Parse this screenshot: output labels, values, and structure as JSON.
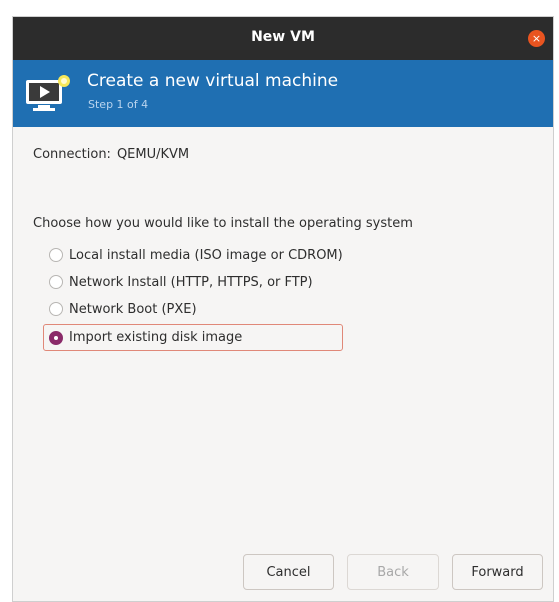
{
  "window": {
    "title": "New VM",
    "close_icon": "close-icon",
    "close_glyph": "×"
  },
  "banner": {
    "icon": "virtual-machine-icon",
    "title": "Create a new virtual machine",
    "step": "Step 1 of 4"
  },
  "connection": {
    "label": "Connection:",
    "value": "QEMU/KVM"
  },
  "install": {
    "prompt": "Choose how you would like to install the operating system",
    "options": [
      {
        "label": "Local install media (ISO image or CDROM)",
        "selected": false
      },
      {
        "label": "Network Install (HTTP, HTTPS, or FTP)",
        "selected": false
      },
      {
        "label": "Network Boot (PXE)",
        "selected": false
      },
      {
        "label": "Import existing disk image",
        "selected": true
      }
    ]
  },
  "buttons": {
    "cancel": "Cancel",
    "back": "Back",
    "forward": "Forward"
  },
  "colors": {
    "titlebar": "#2c2c2c",
    "banner": "#1f6fb2",
    "close": "#e95420",
    "radio_selected": "#8a2a69",
    "selection_outline": "#e08878"
  }
}
